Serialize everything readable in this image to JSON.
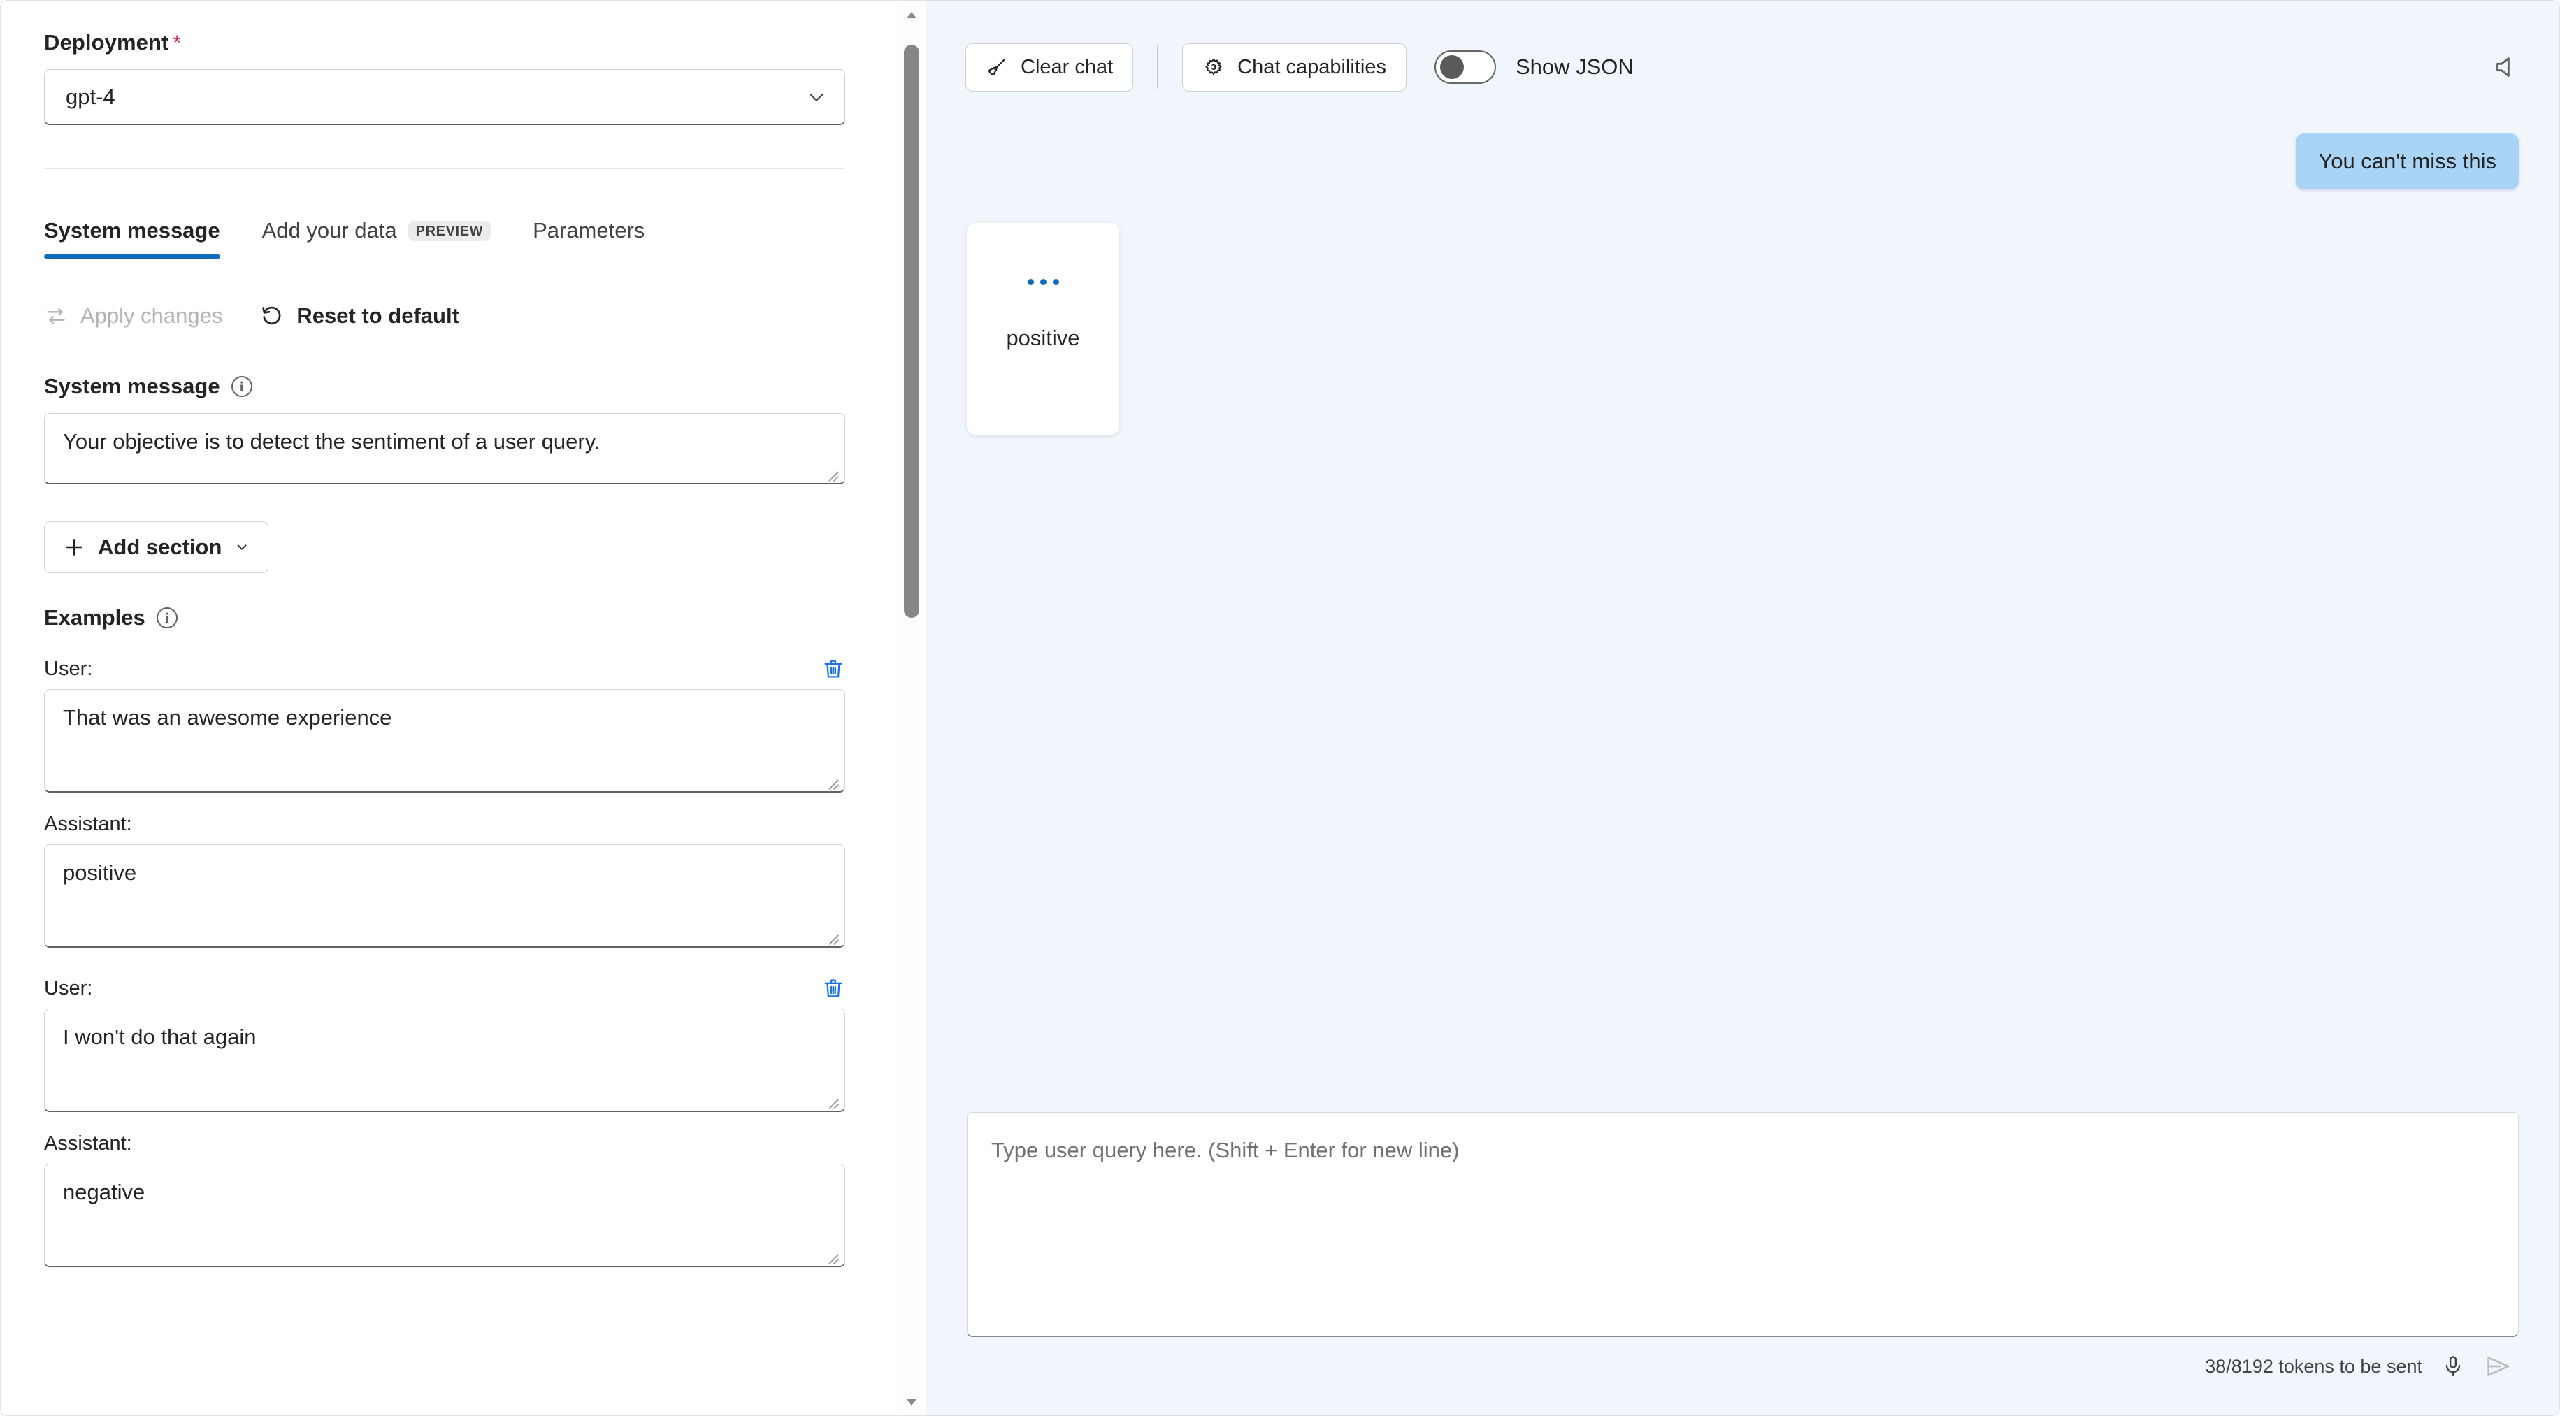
{
  "left_panel": {
    "deployment": {
      "label": "Deployment",
      "required_marker": "*",
      "selected_value": "gpt-4",
      "chevron_icon": "chevron-down-icon"
    },
    "tabs": [
      {
        "label": "System message",
        "active": true,
        "badge": ""
      },
      {
        "label": "Add your data",
        "active": false,
        "badge": "PREVIEW"
      },
      {
        "label": "Parameters",
        "active": false,
        "badge": ""
      }
    ],
    "actions": [
      {
        "label": "Apply changes",
        "icon": "apply-changes-icon",
        "disabled": true
      },
      {
        "label": "Reset to default",
        "icon": "reset-icon",
        "disabled": false
      }
    ],
    "system_message": {
      "label": "System message",
      "info_icon": "info-icon",
      "value": "Your objective is to detect the sentiment of a user query."
    },
    "add_section": {
      "label": "Add section",
      "plus_icon": "plus-icon",
      "chevron_icon": "chevron-down-icon"
    },
    "examples": {
      "label": "Examples",
      "info_icon": "info-icon",
      "user_label": "User:",
      "assistant_label": "Assistant:",
      "delete_icon": "trash-icon",
      "items": [
        {
          "user": "That was an awesome experience",
          "assistant": "positive"
        },
        {
          "user": "I won't do that again",
          "assistant": "negative"
        }
      ]
    },
    "scrollbar": {
      "up_icon": "chevron-up-icon",
      "down_icon": "chevron-down-icon"
    }
  },
  "right_panel": {
    "toolbar": {
      "clear_chat": {
        "label": "Clear chat",
        "icon": "broom-icon"
      },
      "chat_capabilities": {
        "label": "Chat capabilities",
        "icon": "gear-icon"
      },
      "show_json": {
        "label": "Show JSON",
        "enabled": false
      },
      "speaker": {
        "icon": "speaker-icon"
      }
    },
    "messages": [
      {
        "role": "user",
        "text": "You can't miss this"
      },
      {
        "role": "assistant",
        "text": "positive",
        "loading_dots": "..."
      }
    ],
    "composer": {
      "placeholder": "Type user query here. (Shift + Enter for new line)",
      "value": "",
      "token_count": "38/8192 tokens to be sent",
      "mic_icon": "microphone-icon",
      "send_icon": "send-icon"
    }
  },
  "colors": {
    "accent": "#0f6cbd",
    "user_bubble": "#a9d4f5",
    "chat_background": "#f1f6fd",
    "required_star": "#c4314b",
    "delete_icon": "#1a73e8"
  }
}
